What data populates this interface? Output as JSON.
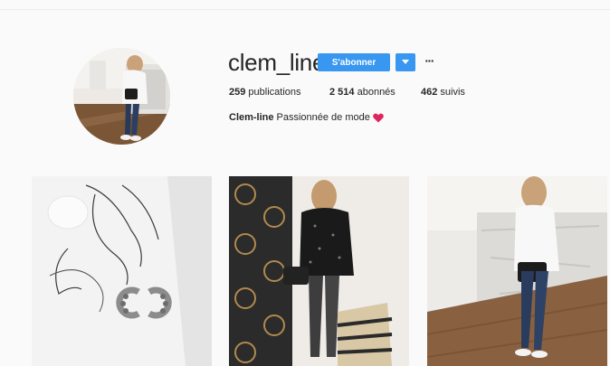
{
  "profile": {
    "username": "clem_line",
    "follow_label": "S'abonner",
    "more_label": "···",
    "stats": {
      "posts_count": "259",
      "posts_label": "publications",
      "followers_count": "2 514",
      "followers_label": "abonnés",
      "following_count": "462",
      "following_label": "suivis"
    },
    "bio": {
      "name": "Clem-line",
      "text": "Passionnée de mode"
    }
  },
  "icons": {
    "dropdown": "chevron-down-icon",
    "more": "more-icon",
    "heart": "heart-emoji-icon"
  },
  "colors": {
    "accent": "#3897f0",
    "heart": "#e0245e"
  }
}
